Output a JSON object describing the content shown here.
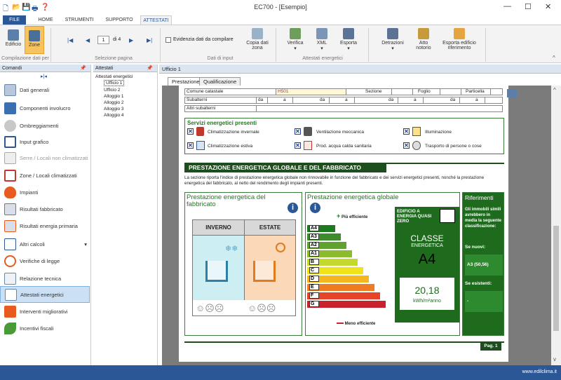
{
  "window": {
    "title": "EC700 - [Esempio]"
  },
  "tabs": [
    "FILE",
    "HOME",
    "STRUMENTI",
    "SUPPORTO",
    "ATTESTATI"
  ],
  "ribbon": {
    "edificio": "Edificio",
    "zone": "Zone",
    "group1": "Compilazione dati per",
    "page_num": "1",
    "page_of": "di 4",
    "group2": "Selezione pagina",
    "evidenzia": "Evidenzia dati da compilare",
    "copia_dati": "Copia dati",
    "copia_zona": "zona",
    "group3": "Dati di input",
    "verifica": "Verifica",
    "xml": "XML",
    "esporta": "Esporta",
    "group4": "Attestati energetici",
    "detrazioni": "Detrazioni",
    "atto": "Atto",
    "notorio": "notorio",
    "esporta_edificio": "Esporta edificio",
    "riferimento": "riferimento"
  },
  "commands": {
    "header": "Comandi",
    "items": [
      "Dati generali",
      "Componenti involucro",
      "Ombreggiamenti",
      "Input grafico",
      "Serre / Locali non climatizzati",
      "Zone / Locali climatizzati",
      "Impianti",
      "Risultati fabbricato",
      "Risultati energia primaria",
      "Altri calcoli",
      "Verifiche di legge",
      "Relazione tecnica",
      "Attestati energetici",
      "Interventi migliorativi",
      "Incentivi fiscali"
    ]
  },
  "attestati": {
    "header": "Attestati",
    "root": "Attestati energetici",
    "children": [
      "Ufficio 1",
      "Ufficio 2",
      "Alloggio 1",
      "Alloggio 2",
      "Alloggio 3",
      "Alloggio 4"
    ]
  },
  "doc": {
    "title": "Ufficio 1",
    "tab1": "Prestazione",
    "tab2": "Qualificazione"
  },
  "form": {
    "comune": "Comune catastale",
    "comune_val": "H501",
    "sezione": "Sezione",
    "foglio": "Foglio",
    "particella": "Particella",
    "subalterni": "Subalterni",
    "da": "da",
    "a": "a",
    "altri": "Altri subalterni"
  },
  "services": {
    "title": "Servizi energetici presenti",
    "items": [
      "Climatizzazione invernale",
      "Ventilazione meccanica",
      "Illuminazione",
      "Climatizzazione estiva",
      "Prod. acqua calda sanitaria",
      "Trasporto di persone o cose"
    ]
  },
  "prestazione": {
    "header": "PRESTAZIONE ENERGETICA GLOBALE E DEL FABBRICATO",
    "description": "La sezione riporta l'indice di prestazione energetica globale non rinnovabile in funzione del fabbricato e dei servizi energetici presenti, nonché la prestazione energetica del fabbricato, al netto del rendimento degli impianti presenti.",
    "fabbricato_title": "Prestazione energetica del fabbricato",
    "inverno": "INVERNO",
    "estate": "ESTATE",
    "globale_title": "Prestazione energetica globale",
    "piu_efficiente": "Più efficiente",
    "meno_efficiente": "Meno efficiente",
    "classes": [
      "A4",
      "A3",
      "A2",
      "A1",
      "B",
      "C",
      "D",
      "E",
      "F",
      "G"
    ],
    "nzeb": "EDIFICIO A ENERGIA QUASI ZERO",
    "classe": "CLASSE",
    "energetica": "ENERGETICA",
    "classe_val": "A4",
    "indice": "20,18",
    "unit": "kWh/m²anno",
    "riferimenti_title": "Riferimenti",
    "riferimenti_text": "Gli immobili simili avrebbero in media la seguente classificazione:",
    "nuovi": "Se nuovi:",
    "nuovi_val": "A3 (50,56)",
    "esistenti": "Se esistenti:",
    "esistenti_val": "-",
    "page": "Pag. 1"
  },
  "status": {
    "site": "www.edilclima.it"
  },
  "colors": {
    "accent": "#2b5797",
    "green": "#1e4d1e"
  }
}
